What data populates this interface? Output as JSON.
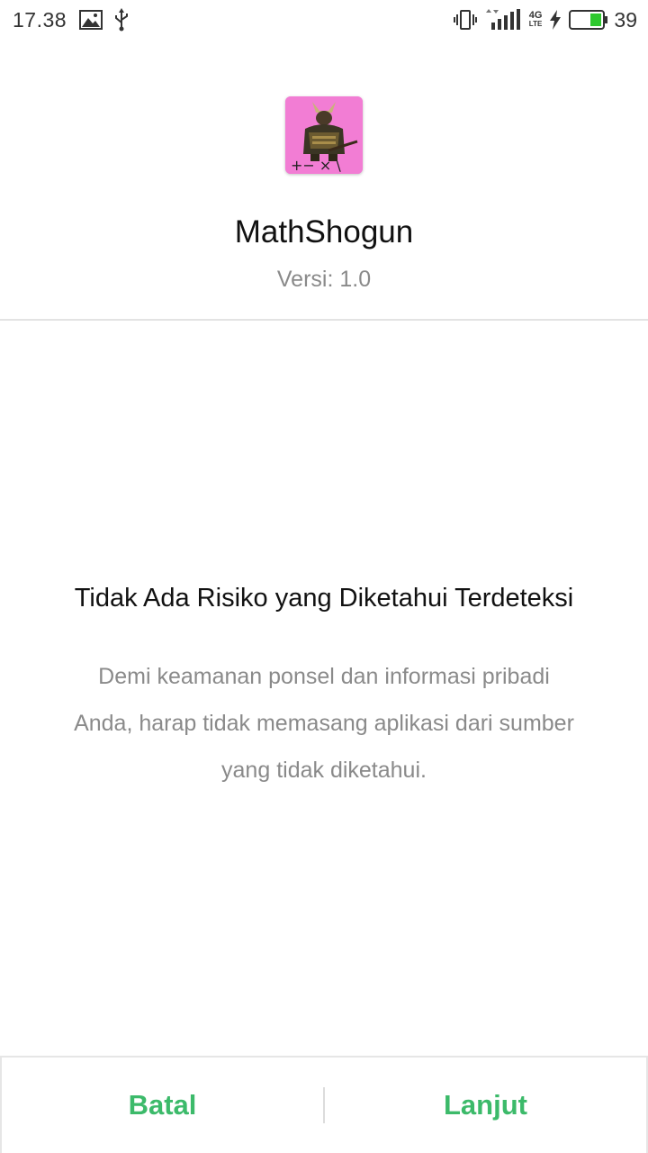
{
  "status_bar": {
    "time": "17.38",
    "network_top": "4G",
    "network_bottom": "LTE",
    "battery_percent": "39",
    "battery_color": "#2ec82e",
    "icons": [
      "image-icon",
      "usb-icon",
      "vibrate-icon",
      "signal-icon",
      "network-4g-lte-icon",
      "charging-icon",
      "battery-icon"
    ]
  },
  "app": {
    "name": "MathShogun",
    "version_label": "Versi:",
    "version_value": "1.0",
    "icon_color": "#f27dd4",
    "icon_symbols": "+− × \\"
  },
  "message": {
    "title": "Tidak Ada Risiko yang Diketahui Terdeteksi",
    "body_lines": [
      "Demi keamanan ponsel dan informasi pribadi",
      "Anda, harap tidak memasang aplikasi dari sumber",
      "yang tidak diketahui."
    ]
  },
  "actions": {
    "cancel_label": "Batal",
    "continue_label": "Lanjut",
    "accent_color": "#3cba6a"
  }
}
